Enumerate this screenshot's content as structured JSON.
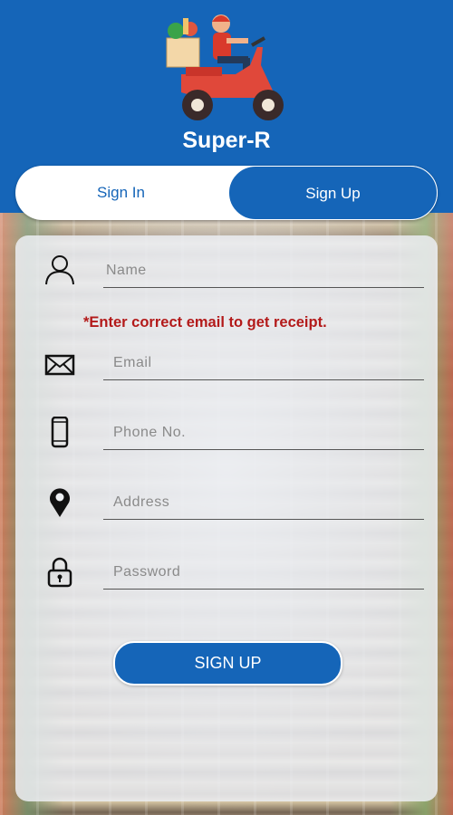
{
  "app": {
    "title": "Super-R"
  },
  "tabs": {
    "sign_in": "Sign In",
    "sign_up": "Sign Up",
    "active": "Sign Up"
  },
  "form": {
    "name_placeholder": "Name",
    "email_notice": "*Enter correct email to get receipt.",
    "email_placeholder": "Email",
    "phone_placeholder": "Phone No.",
    "address_placeholder": "Address",
    "password_placeholder": "Password",
    "submit_label": "SIGN UP"
  },
  "colors": {
    "primary": "#1565b8",
    "notice": "#b31a1a",
    "white": "#ffffff"
  },
  "icons": [
    "scooter-delivery-logo",
    "person-icon",
    "envelope-icon",
    "phone-icon",
    "location-pin-icon",
    "lock-icon"
  ]
}
